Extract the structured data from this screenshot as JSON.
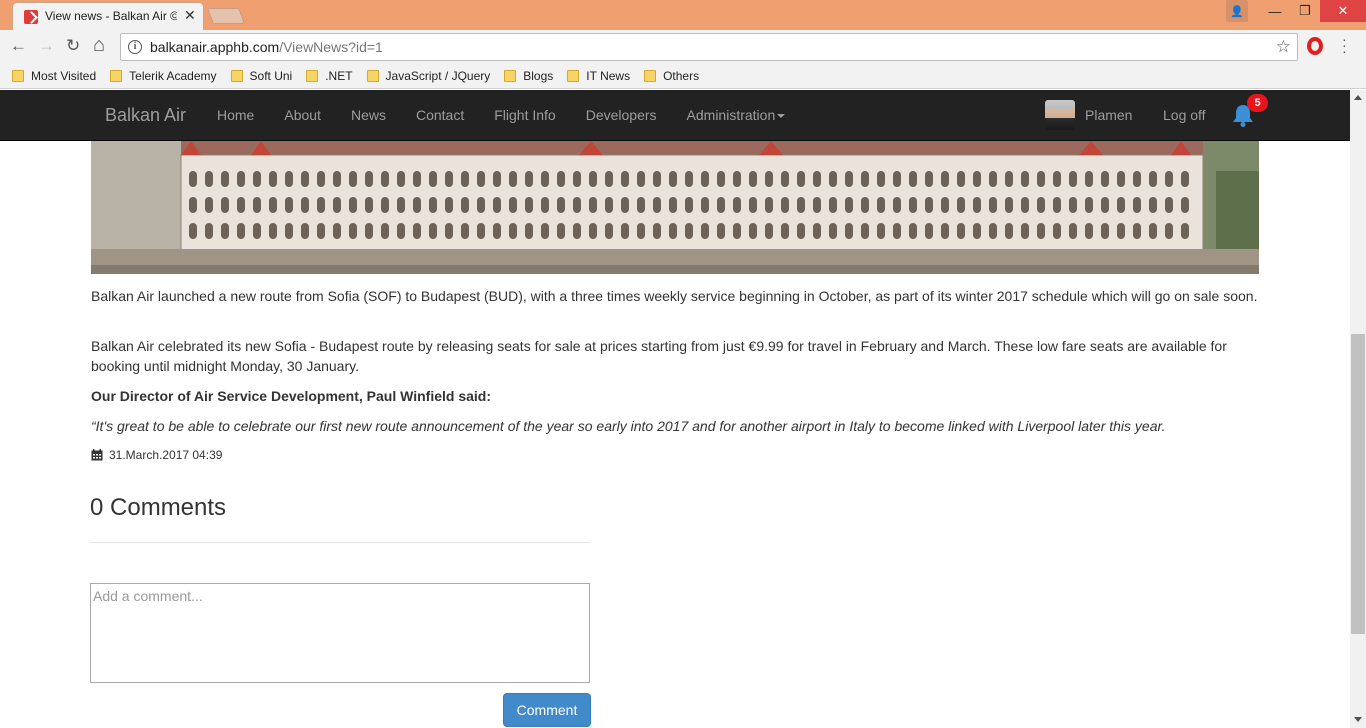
{
  "browser": {
    "tab": {
      "title": "View news - Balkan Air ©",
      "close_glyph": "✕"
    },
    "window_buttons": {
      "user": "👤",
      "minimize": "—",
      "restore": "❐",
      "close": "✕"
    },
    "nav": {
      "back": "←",
      "forward": "→",
      "reload": "↻",
      "home": "⌂"
    },
    "address": {
      "host": "balkanair.apphb.com",
      "path": "/ViewNews?id=1",
      "info": "i",
      "star": "☆"
    },
    "bookmarks": [
      "Most Visited",
      "Telerik Academy",
      "Soft Uni",
      ".NET",
      "JavaScript / JQuery",
      "Blogs",
      "IT News",
      "Others"
    ]
  },
  "site": {
    "brand": "Balkan Air",
    "nav": [
      "Home",
      "About",
      "News",
      "Contact",
      "Flight Info",
      "Developers",
      "Administration"
    ],
    "user": "Plamen",
    "logoff": "Log off",
    "notifications": "5",
    "bell_color": "#3a8fd6",
    "navbar_color": "#222222"
  },
  "article": {
    "p1": "Balkan Air launched a new route from Sofia (SOF) to Budapest (BUD), with a three times weekly service beginning in October, as part of its winter 2017 schedule which will go on sale soon.",
    "p2": "Balkan Air celebrated its new Sofia - Budapest route by releasing seats for sale at prices starting from just €9.99 for travel in February and March. These low fare seats are available for booking until midnight Monday, 30 January.",
    "p3": "Our Director of Air Service Development, Paul Winfield said:",
    "p4": "“It's great to be able to celebrate our first new route announcement of the year so early into 2017 and for another airport in Italy to become linked with Liverpool later this year.",
    "date": "31.March.2017 04:39"
  },
  "comments": {
    "title": "0 Comments",
    "placeholder": "Add a comment...",
    "button": "Comment",
    "button_color": "#428bca"
  }
}
